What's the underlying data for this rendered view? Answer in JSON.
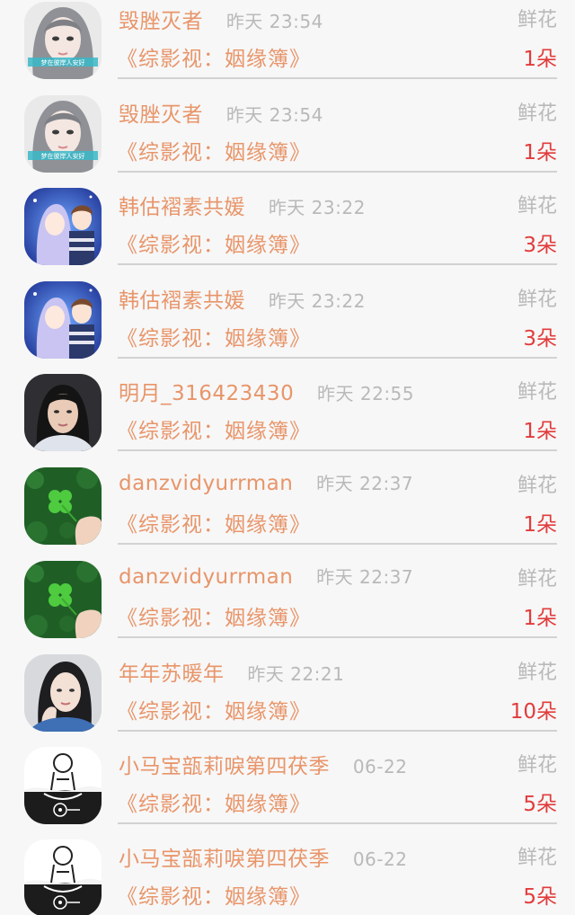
{
  "records": [
    {
      "user": "毁脞灭者",
      "time": "昨天 23:54",
      "gift": "鲜花",
      "book": "《综影视：姻缘簿》",
      "count": "1朵",
      "avatar": "girl-gray-hair-avatar",
      "avatar_caption": "梦在彼岸人安好"
    },
    {
      "user": "毁脞灭者",
      "time": "昨天 23:54",
      "gift": "鲜花",
      "book": "《综影视：姻缘簿》",
      "count": "1朵",
      "avatar": "girl-gray-hair-avatar",
      "avatar_caption": "梦在彼岸人安好"
    },
    {
      "user": "韩估褶素共媛",
      "time": "昨天 23:22",
      "gift": "鲜花",
      "book": "《综影视：姻缘簿》",
      "count": "3朵",
      "avatar": "anime-couple-avatar"
    },
    {
      "user": "韩估褶素共媛",
      "time": "昨天 23:22",
      "gift": "鲜花",
      "book": "《综影视：姻缘簿》",
      "count": "3朵",
      "avatar": "anime-couple-avatar"
    },
    {
      "user": "明月_316423430",
      "time": "昨天 22:55",
      "gift": "鲜花",
      "book": "《综影视：姻缘簿》",
      "count": "1朵",
      "avatar": "woman-portrait-avatar"
    },
    {
      "user": "danzvidyurrman",
      "time": "昨天 22:37",
      "gift": "鲜花",
      "book": "《综影视：姻缘簿》",
      "count": "1朵",
      "avatar": "four-leaf-clover-avatar"
    },
    {
      "user": "danzvidyurrman",
      "time": "昨天 22:37",
      "gift": "鲜花",
      "book": "《综影视：姻缘簿》",
      "count": "1朵",
      "avatar": "four-leaf-clover-avatar"
    },
    {
      "user": "年年苏暖年",
      "time": "昨天 22:21",
      "gift": "鲜花",
      "book": "《综影视：姻缘簿》",
      "count": "10朵",
      "avatar": "woman-hand-on-face-avatar"
    },
    {
      "user": "小马宝瓿莉唳第四茯季",
      "time": "06-22",
      "gift": "鲜花",
      "book": "《综影视：姻缘簿》",
      "count": "5朵",
      "avatar": "bw-illustration-avatar"
    },
    {
      "user": "小马宝瓿莉唳第四茯季",
      "time": "06-22",
      "gift": "鲜花",
      "book": "《综影视：姻缘簿》",
      "count": "5朵",
      "avatar": "bw-illustration-avatar"
    }
  ],
  "colors": {
    "name": "#e8956a",
    "time": "#b9b9b9",
    "count": "#e23c3c",
    "divider": "#d2d2d2",
    "background": "#f7f7f7"
  }
}
